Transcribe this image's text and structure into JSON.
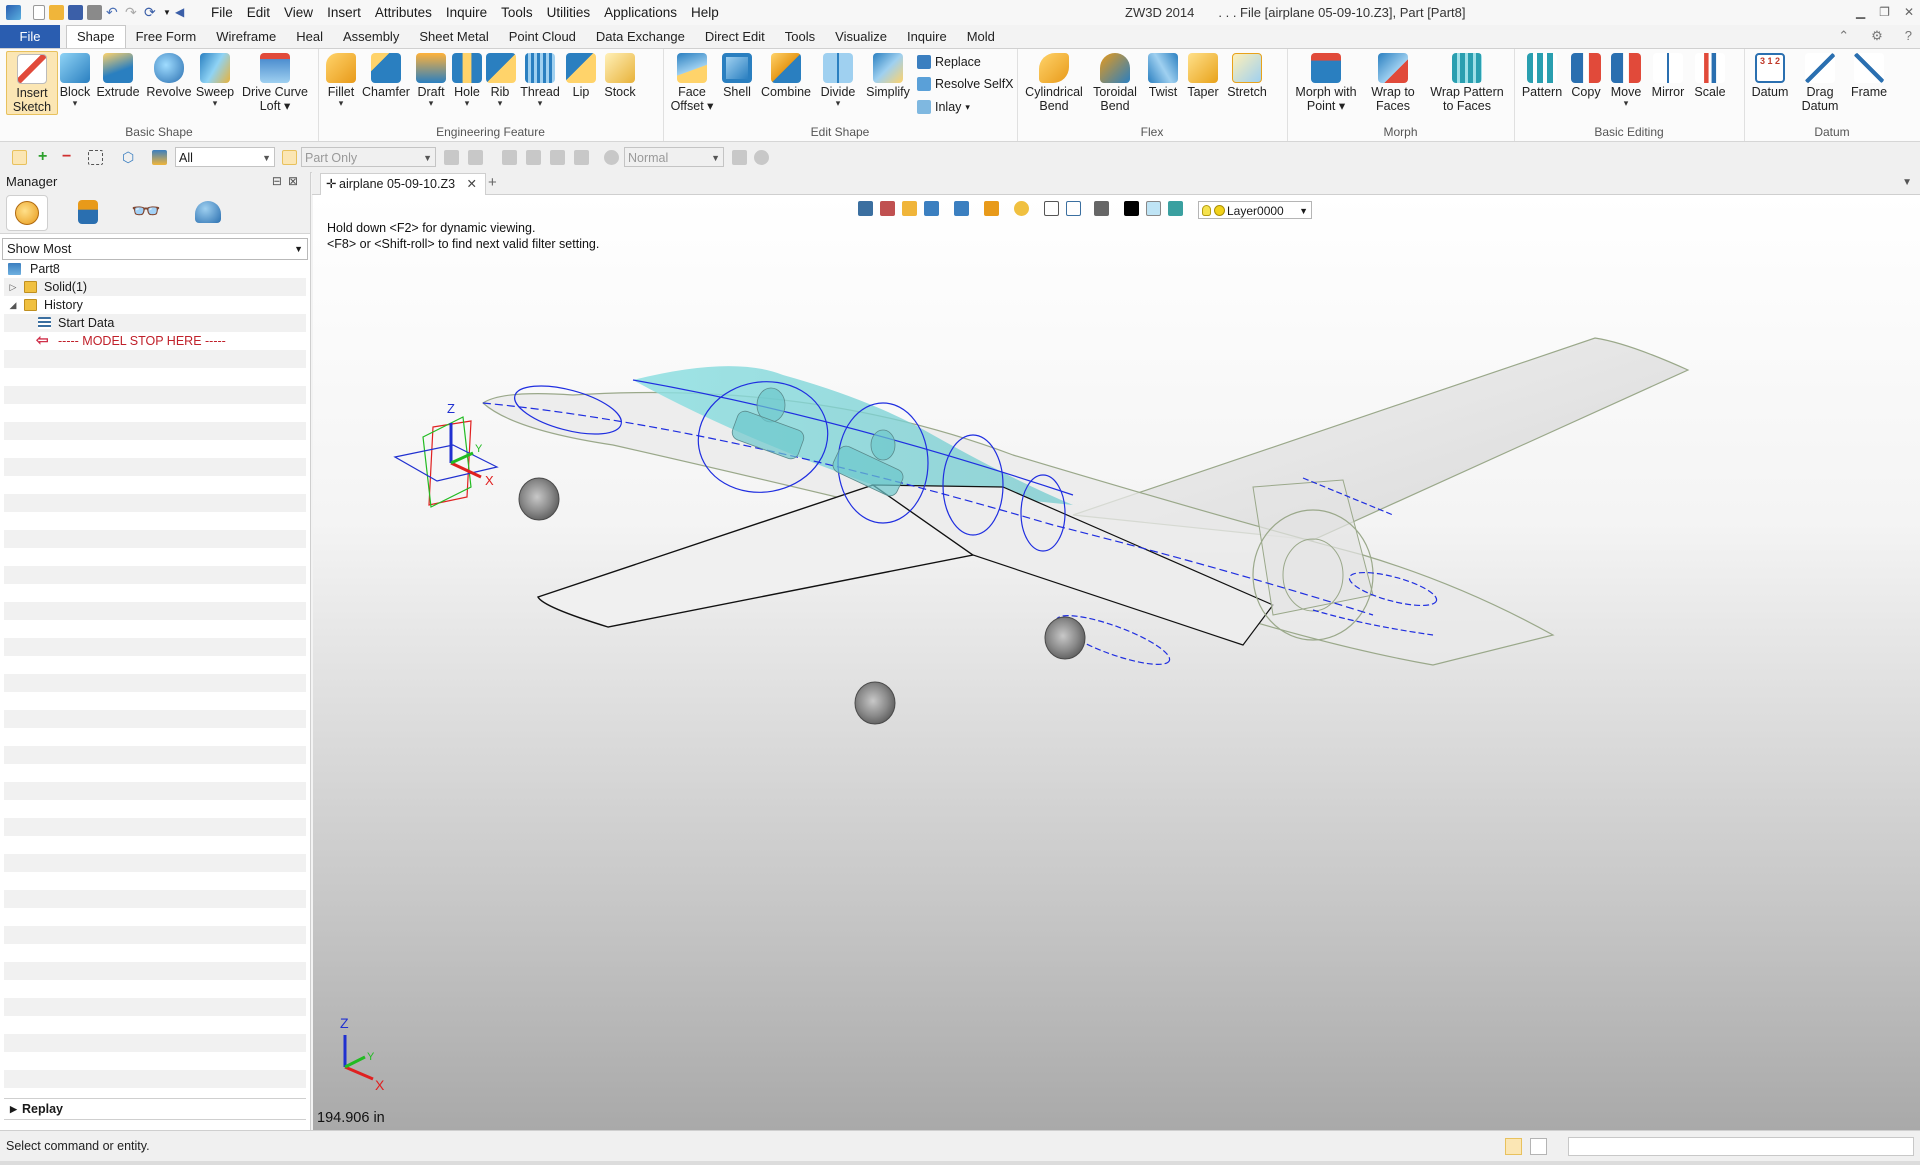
{
  "app": {
    "name": "ZW3D 2014",
    "file_title": ". . . File [airplane 05-09-10.Z3],  Part [Part8]"
  },
  "menu": [
    "File",
    "Edit",
    "View",
    "Insert",
    "Attributes",
    "Inquire",
    "Tools",
    "Utilities",
    "Applications",
    "Help"
  ],
  "ribbon_tabs": [
    "File",
    "Shape",
    "Free Form",
    "Wireframe",
    "Heal",
    "Assembly",
    "Sheet Metal",
    "Point Cloud",
    "Data Exchange",
    "Direct Edit",
    "Tools",
    "Visualize",
    "Inquire",
    "Mold"
  ],
  "active_ribbon_tab": "Shape",
  "ribbon": {
    "basic_shape": {
      "label": "Basic Shape",
      "buttons": [
        {
          "l1": "Insert",
          "l2": "Sketch"
        },
        {
          "l1": "Block",
          "l2": ""
        },
        {
          "l1": "Extrude",
          "l2": ""
        },
        {
          "l1": "Revolve",
          "l2": ""
        },
        {
          "l1": "Sweep",
          "l2": ""
        },
        {
          "l1": "Drive Curve",
          "l2": "Loft"
        }
      ]
    },
    "engineering_feature": {
      "label": "Engineering Feature",
      "buttons": [
        "Fillet",
        "Chamfer",
        "Draft",
        "Hole",
        "Rib",
        "Thread",
        "Lip",
        "Stock"
      ]
    },
    "edit_shape": {
      "label": "Edit Shape",
      "buttons": [
        {
          "l1": "Face",
          "l2": "Offset"
        },
        {
          "l1": "Shell",
          "l2": ""
        },
        {
          "l1": "Combine",
          "l2": ""
        },
        {
          "l1": "Divide",
          "l2": ""
        },
        {
          "l1": "Simplify",
          "l2": ""
        }
      ],
      "small": [
        "Replace",
        "Resolve SelfX",
        "Inlay"
      ]
    },
    "flex": {
      "label": "Flex",
      "buttons": [
        {
          "l1": "Cylindrical",
          "l2": "Bend"
        },
        {
          "l1": "Toroidal",
          "l2": "Bend"
        },
        {
          "l1": "Twist",
          "l2": ""
        },
        {
          "l1": "Taper",
          "l2": ""
        },
        {
          "l1": "Stretch",
          "l2": ""
        }
      ]
    },
    "morph": {
      "label": "Morph",
      "buttons": [
        {
          "l1": "Morph with",
          "l2": "Point"
        },
        {
          "l1": "Wrap to",
          "l2": "Faces"
        },
        {
          "l1": "Wrap Pattern",
          "l2": "to Faces"
        }
      ]
    },
    "basic_editing": {
      "label": "Basic Editing",
      "buttons": [
        "Pattern",
        "Copy",
        "Move",
        "Mirror",
        "Scale"
      ]
    },
    "datum": {
      "label": "Datum",
      "buttons": [
        {
          "l1": "Datum",
          "l2": ""
        },
        {
          "l1": "Drag",
          "l2": "Datum"
        },
        {
          "l1": "Frame",
          "l2": ""
        }
      ],
      "datum_icon_text": "3 1 2"
    }
  },
  "filterbar": {
    "filter_value": "All",
    "scope_value": "Part Only",
    "mode_value": "Normal"
  },
  "manager": {
    "title": "Manager",
    "show_option": "Show Most",
    "tree": [
      {
        "label": "Part8",
        "level": 0,
        "icon": "part-icon",
        "expander": ""
      },
      {
        "label": "Solid(1)",
        "level": 1,
        "icon": "folder-icon",
        "expander": "▷"
      },
      {
        "label": "History",
        "level": 1,
        "icon": "folder-open-icon",
        "expander": "◢"
      },
      {
        "label": "Start Data",
        "level": 2,
        "icon": "start-data-icon",
        "expander": ""
      },
      {
        "label": "----- MODEL STOP HERE -----",
        "level": 2,
        "icon": "stop-arrow-icon",
        "expander": ""
      }
    ],
    "replay_label": "Replay"
  },
  "document": {
    "tab_label": "airplane 05-09-10.Z3",
    "hint_line1": "Hold down <F2> for dynamic viewing.",
    "hint_line2": "<F8> or <Shift-roll> to find next valid filter setting.",
    "layer": "Layer0000",
    "scale_readout": "194.906 in"
  },
  "axes": {
    "x": "X",
    "y": "Y",
    "z": "Z"
  },
  "status": {
    "message": "Select command or entity."
  },
  "colors": {
    "accent": "#2a5db0",
    "canopy": "#7fd6d8",
    "wireframe_blue": "#1f2ee0",
    "wireframe_green": "#8fa87a",
    "selected_bg": "#fbe6b4"
  }
}
